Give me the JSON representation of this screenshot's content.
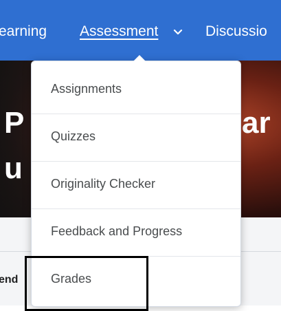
{
  "navbar": {
    "items": [
      {
        "label": "earning"
      },
      {
        "label": "Assessment"
      },
      {
        "label": "Discussio"
      }
    ],
    "active_color": "#2f6fd1"
  },
  "hero": {
    "text_left_top": "P",
    "text_left_bottom": "u",
    "text_right": "ar"
  },
  "page": {
    "side_text": "end"
  },
  "dropdown": {
    "items": [
      {
        "label": "Assignments"
      },
      {
        "label": "Quizzes"
      },
      {
        "label": "Originality Checker"
      },
      {
        "label": "Feedback and Progress"
      },
      {
        "label": "Grades"
      }
    ]
  }
}
